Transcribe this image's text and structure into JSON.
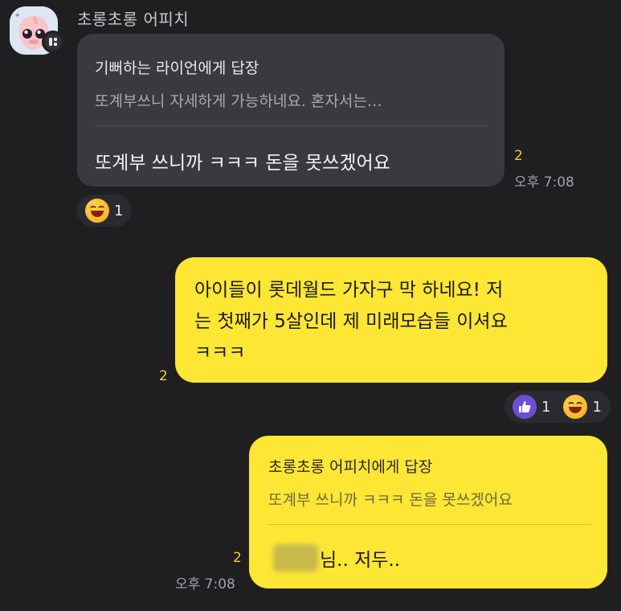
{
  "chat": {
    "sender_name": "초롱초롱 어피치",
    "incoming": {
      "reply_title": "기뻐하는 라이언에게 답장",
      "reply_quote": "또계부쓰니 자세하게 가능하네요. 혼자서는…",
      "text": "또계부 쓰니까 ㅋㅋㅋ 돈을 못쓰겠어요",
      "unread_count": "2",
      "time": "오후 7:08",
      "reaction": {
        "icon": "grinning-face-icon",
        "count": "1"
      }
    },
    "outgoing_1": {
      "text": "아이들이 롯데월드 가자구 막 하네요! 저\n는 첫째가 5살인데 제 미래모습들 이셔요\nㅋㅋㅋ",
      "unread_count": "2",
      "reactions": [
        {
          "icon": "thumbs-up-icon",
          "count": "1"
        },
        {
          "icon": "grinning-face-icon",
          "count": "1"
        }
      ]
    },
    "outgoing_2": {
      "reply_title": "초롱초롱 어피치에게 답장",
      "reply_quote": "또계부 쓰니까 ㅋㅋㅋ 돈을 못쓰겠어요",
      "text": "님.. 저두..",
      "unread_count": "2",
      "time": "오후 7:08"
    }
  },
  "colors": {
    "background": "#1f1f22",
    "incoming_bubble": "#3a3a3e",
    "outgoing_bubble": "#fde634",
    "unread_count": "#f2cf2a",
    "like_badge": "#6c4fd6"
  }
}
